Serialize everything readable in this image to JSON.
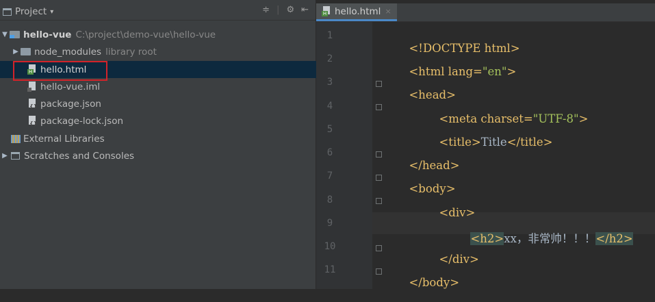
{
  "project_panel": {
    "header": {
      "title": "Project",
      "dropdown": "▾",
      "tools": [
        "≑",
        "⚙",
        "⇤"
      ]
    },
    "tree": [
      {
        "name": "hello-vue",
        "hint": "C:\\project\\demo-vue\\hello-vue",
        "icon": "module-folder-icon",
        "expanded": true
      },
      {
        "name": "node_modules",
        "hint": "library root",
        "icon": "folder-icon",
        "expanded": false
      },
      {
        "name": "hello.html",
        "icon": "html-file-icon",
        "selected": true
      },
      {
        "name": "hello-vue.iml",
        "icon": "iml-file-icon"
      },
      {
        "name": "package.json",
        "icon": "json-file-icon"
      },
      {
        "name": "package-lock.json",
        "icon": "json-file-icon"
      },
      {
        "name": "External Libraries",
        "icon": "libraries-icon"
      },
      {
        "name": "Scratches and Consoles",
        "icon": "scratches-icon",
        "expanded": false
      }
    ]
  },
  "editor": {
    "tab": {
      "label": "hello.html",
      "close": "×"
    },
    "lines": [
      {
        "n": "1",
        "tokens": [
          "<!DOCTYPE html>"
        ]
      },
      {
        "n": "2",
        "tokens": [
          "<html lang=",
          "\"en\"",
          ">"
        ]
      },
      {
        "n": "3",
        "tokens": [
          "<head>"
        ]
      },
      {
        "n": "4",
        "tokens": [
          "<meta charset=",
          "\"UTF-8\"",
          ">"
        ]
      },
      {
        "n": "5",
        "tokens": [
          "<title>",
          "Title",
          "</title>"
        ]
      },
      {
        "n": "6",
        "tokens": [
          "</head>"
        ]
      },
      {
        "n": "7",
        "tokens": [
          "<body>"
        ]
      },
      {
        "n": "8",
        "tokens": [
          "<div>"
        ]
      },
      {
        "n": "9",
        "tokens": [
          "<h2>",
          "xx，非常帅！！！",
          "</h2>"
        ]
      },
      {
        "n": "10",
        "tokens": [
          "</div>"
        ]
      },
      {
        "n": "11",
        "tokens": [
          "</body>"
        ]
      }
    ]
  },
  "colors": {
    "tag": "#e8bf6a",
    "string": "#a5c25c",
    "text": "#a9b7c6",
    "selection": "#0d293e",
    "highlight_border": "#d2232a"
  }
}
